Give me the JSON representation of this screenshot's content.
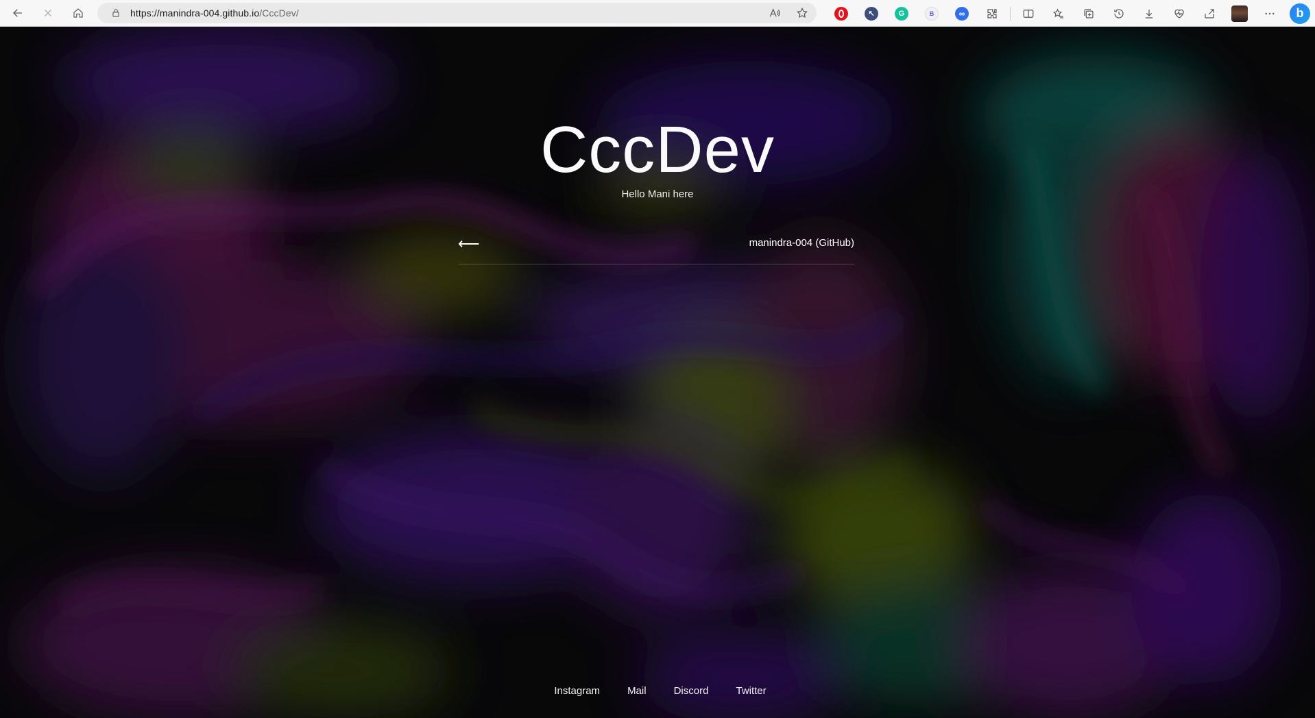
{
  "browser": {
    "url_host": "https://manindra-004.github.io",
    "url_path": "/CccDev/"
  },
  "page": {
    "title": "CccDev",
    "subtitle": "Hello Mani here",
    "back_arrow": "⟵",
    "github_link": "manindra-004 (GitHub)"
  },
  "footer": {
    "links": [
      "Instagram",
      "Mail",
      "Discord",
      "Twitter"
    ]
  },
  "colors": {
    "background": "#0a0a0c",
    "text": "#ffffff",
    "fluid_purple": "#5b1fa6",
    "fluid_magenta": "#8a1f5a",
    "fluid_olive": "#4f5a10",
    "fluid_teal": "#126e62"
  },
  "icons": {
    "back": "back-arrow-icon",
    "refresh": "stop-icon",
    "home": "home-icon",
    "lock": "lock-icon",
    "read_aloud": "read-aloud-icon",
    "favorite": "star-icon",
    "extensions": "puzzle-icon",
    "split": "split-screen-icon",
    "favorites": "favorites-icon",
    "collections": "collections-icon",
    "history": "history-icon",
    "downloads": "download-icon",
    "performance": "heart-pulse-icon",
    "share": "share-icon",
    "menu": "more-icon",
    "copilot": "bing-icon"
  }
}
